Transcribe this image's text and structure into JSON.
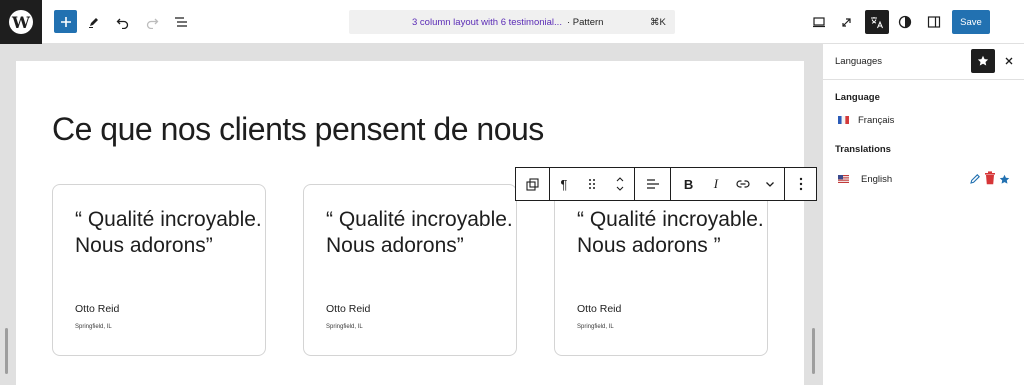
{
  "toolbar": {
    "command_title": "3 column layout with 6 testimonial...",
    "command_kind": "· Pattern",
    "command_shortcut": "⌘K",
    "save_label": "Save"
  },
  "canvas": {
    "heading": "Ce que nos clients pensent de nous",
    "cards": [
      {
        "quote": "“ Qualité incroyable. Nous adorons”",
        "author": "Otto Reid",
        "location": "Springfield, IL"
      },
      {
        "quote": "“ Qualité incroyable. Nous adorons”",
        "author": "Otto Reid",
        "location": "Springfield, IL"
      },
      {
        "quote": "“ Qualité incroyable. Nous adorons ”",
        "author": "Otto Reid",
        "location": "Springfield, IL"
      }
    ]
  },
  "sidebar": {
    "title": "Languages",
    "language_heading": "Language",
    "current_language": "Français",
    "translations_heading": "Translations",
    "translation_language": "English"
  },
  "colors": {
    "accent": "#2271b1",
    "dark": "#1e1e1e",
    "command_title": "#5b2cb6",
    "delete": "#d63638"
  }
}
